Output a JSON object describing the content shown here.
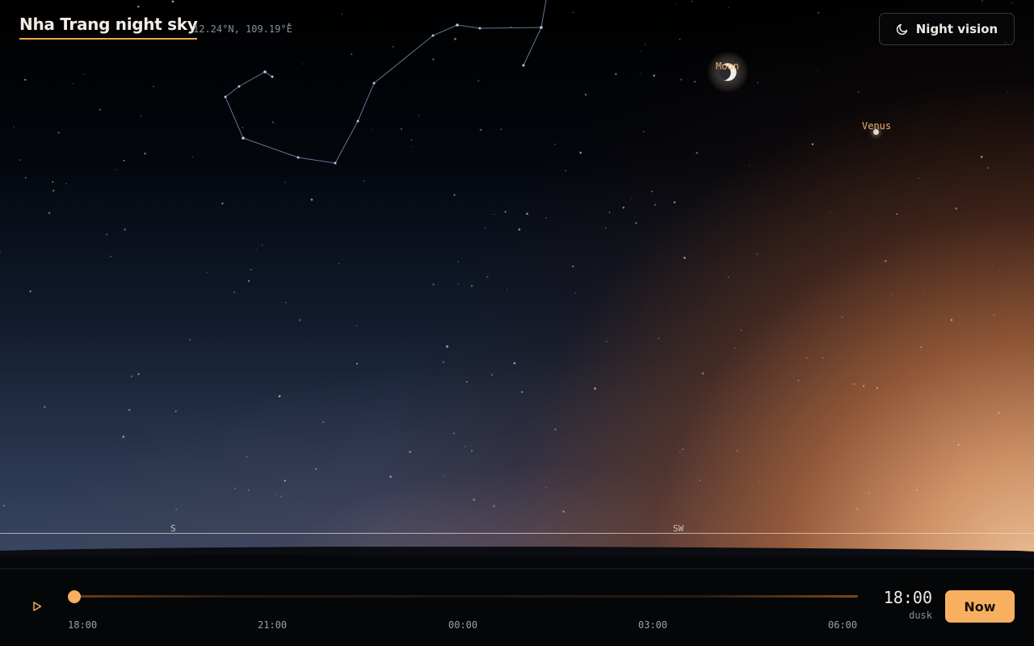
{
  "header": {
    "title": "Nha Trang night sky",
    "coordinates": "12.24°N, 109.19°E"
  },
  "night_vision": {
    "label": "Night vision",
    "icon": "moon-icon"
  },
  "sky": {
    "bodies": {
      "moon_label": "Moon",
      "venus_label": "Venus"
    },
    "compass": [
      "S",
      "SW"
    ]
  },
  "timeline": {
    "play_icon": "play-icon",
    "ticks": [
      "18:00",
      "21:00",
      "00:00",
      "03:00",
      "06:00"
    ],
    "position": 0,
    "current_time": "18:00",
    "phase": "dusk",
    "now_label": "Now"
  },
  "colors": {
    "accent": "#f8b060",
    "constellation_line": "#8a9cc8",
    "planet_label": "#f0b070"
  }
}
